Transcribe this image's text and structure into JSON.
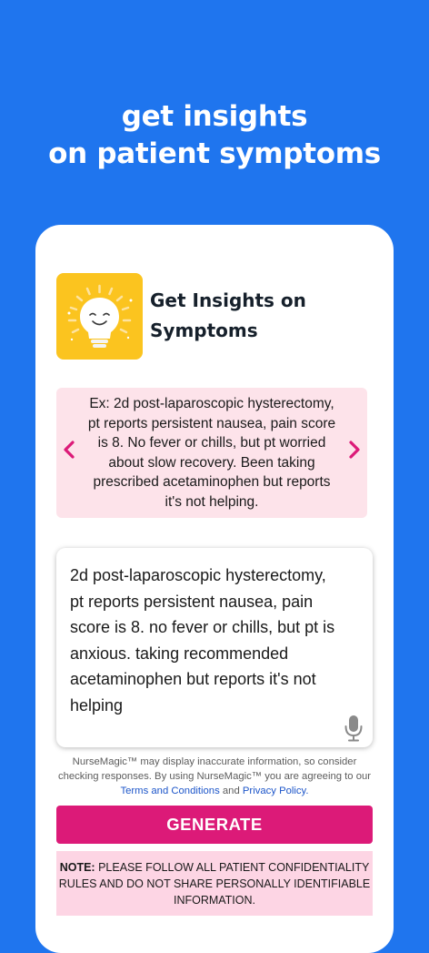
{
  "hero": {
    "line1": "get insights",
    "line2": "on patient symptoms"
  },
  "app": {
    "icon": "lightbulb-icon",
    "title": "Get Insights on Symptoms"
  },
  "example": {
    "text": "Ex: 2d post-laparoscopic hysterectomy, pt reports persistent nausea, pain score is 8. No fever or chills, but pt worried about slow recovery. Been taking prescribed acetaminophen but reports it's not helping.",
    "prev_icon": "chevron-left-icon",
    "next_icon": "chevron-right-icon"
  },
  "input": {
    "value": "2d post-laparoscopic hysterectomy, pt reports persistent nausea, pain score is 8. no fever or chills, but pt is anxious. taking recommended acetaminophen but reports it's not helping",
    "mic_icon": "microphone-icon"
  },
  "disclaimer": {
    "text_before": "NurseMagic™ may display inaccurate information, so consider checking responses.  By using NurseMagic™ you are agreeing to our ",
    "terms_link": "Terms and Conditions",
    "and": " and ",
    "privacy_link": "Privacy Policy."
  },
  "generate_label": "GENERATE",
  "note": {
    "label": "NOTE:",
    "text": "  PLEASE FOLLOW ALL PATIENT CONFIDENTIALITY RULES AND DO NOT SHARE PERSONALLY IDENTIFIABLE INFORMATION."
  },
  "colors": {
    "background": "#1f75ee",
    "accent": "#dc1a78",
    "example_bg": "#fde3ea",
    "note_bg": "#fdd5e4",
    "icon_bg": "#fbc41f",
    "link": "#1c55c9"
  }
}
